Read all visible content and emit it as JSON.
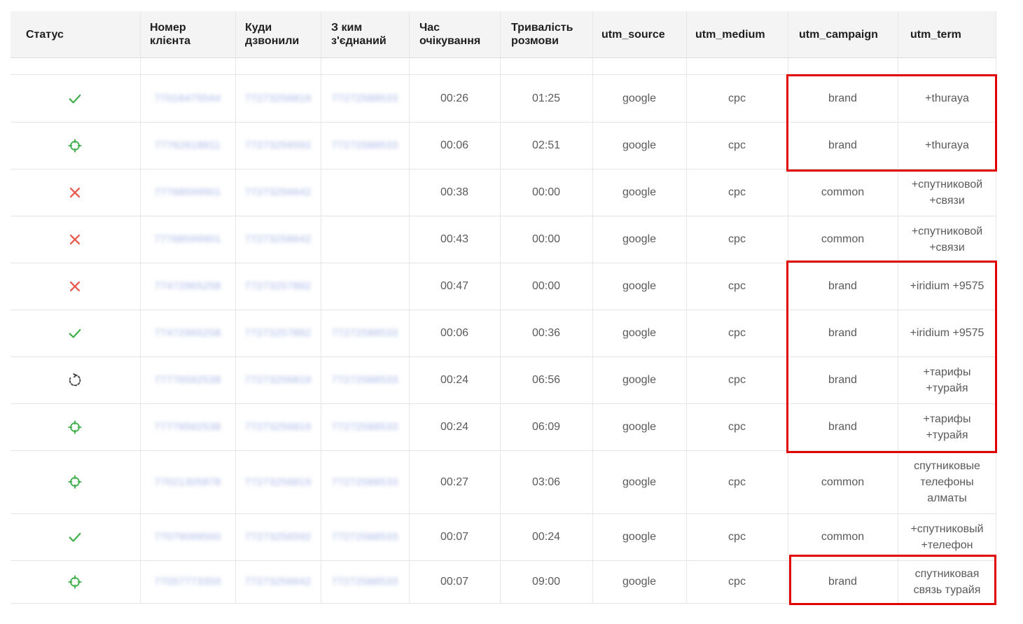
{
  "table": {
    "headers": {
      "status": "Статус",
      "client": "Номер клієнта",
      "called": "Куди дзвонили",
      "connected": "З ким з'єднаний",
      "wait": "Час очікування",
      "duration": "Тривалість розмови",
      "source": "utm_source",
      "medium": "utm_medium",
      "campaign": "utm_campaign",
      "term": "utm_term"
    },
    "rows": [
      {
        "status": "answered-check",
        "client": "77016475544",
        "called": "77273256819",
        "connected": "77272588533",
        "wait": "00:26",
        "duration": "01:25",
        "source": "google",
        "medium": "cpc",
        "campaign": "brand",
        "term": "+thuraya"
      },
      {
        "status": "target-call",
        "client": "77762618811",
        "called": "77273256592",
        "connected": "77272588533",
        "wait": "00:06",
        "duration": "02:51",
        "source": "google",
        "medium": "cpc",
        "campaign": "brand",
        "term": "+thuraya"
      },
      {
        "status": "missed-cross",
        "client": "77768599901",
        "called": "77273256642",
        "connected": "",
        "wait": "00:38",
        "duration": "00:00",
        "source": "google",
        "medium": "cpc",
        "campaign": "common",
        "term": "+спутниковой +связи"
      },
      {
        "status": "missed-cross",
        "client": "77768599901",
        "called": "77273256642",
        "connected": "",
        "wait": "00:43",
        "duration": "00:00",
        "source": "google",
        "medium": "cpc",
        "campaign": "common",
        "term": "+спутниковой +связи"
      },
      {
        "status": "missed-cross",
        "client": "77472965258",
        "called": "77273257882",
        "connected": "",
        "wait": "00:47",
        "duration": "00:00",
        "source": "google",
        "medium": "cpc",
        "campaign": "brand",
        "term": "+iridium +9575"
      },
      {
        "status": "answered-check",
        "client": "77472965258",
        "called": "77273257882",
        "connected": "77272588533",
        "wait": "00:06",
        "duration": "00:36",
        "source": "google",
        "medium": "cpc",
        "campaign": "brand",
        "term": "+iridium +9575"
      },
      {
        "status": "in-progress",
        "client": "77776592538",
        "called": "77273256819",
        "connected": "77272588533",
        "wait": "00:24",
        "duration": "06:56",
        "source": "google",
        "medium": "cpc",
        "campaign": "brand",
        "term": "+тарифы +турайя"
      },
      {
        "status": "target-call",
        "client": "77776592538",
        "called": "77273256819",
        "connected": "77272588533",
        "wait": "00:24",
        "duration": "06:09",
        "source": "google",
        "medium": "cpc",
        "campaign": "brand",
        "term": "+тарифы +турайя"
      },
      {
        "status": "target-call",
        "client": "77021305878",
        "called": "77273256819",
        "connected": "77272588533",
        "wait": "00:27",
        "duration": "03:06",
        "source": "google",
        "medium": "cpc",
        "campaign": "common",
        "term": "спутниковые телефоны алматы"
      },
      {
        "status": "answered-check",
        "client": "77079099500",
        "called": "77273256592",
        "connected": "77272588533",
        "wait": "00:07",
        "duration": "00:24",
        "source": "google",
        "medium": "cpc",
        "campaign": "common",
        "term": "+спутниковый +телефон"
      },
      {
        "status": "target-call",
        "client": "77057773359",
        "called": "77273256642",
        "connected": "77272588533",
        "wait": "00:07",
        "duration": "09:00",
        "source": "google",
        "medium": "cpc",
        "campaign": "brand",
        "term": "спутниковая связь турайя"
      }
    ]
  },
  "colors": {
    "check": "#3fae49",
    "cross": "#e8574a",
    "target": "#3fae49",
    "progress": "#444444",
    "highlight": "#e00000",
    "masked": "#a9b7e6"
  }
}
